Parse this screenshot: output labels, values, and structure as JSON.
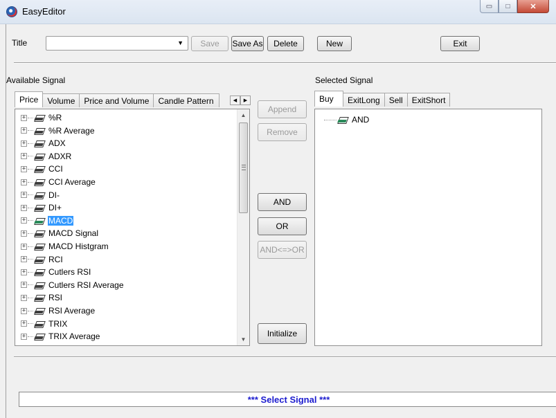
{
  "window": {
    "title": "EasyEditor",
    "min_symbol": "▭",
    "max_symbol": "□",
    "close_symbol": "✕"
  },
  "toolbar": {
    "title_label": "Title",
    "title_value": "",
    "save_label": "Save",
    "save_as_label": "Save As",
    "delete_label": "Delete",
    "new_label": "New",
    "exit_label": "Exit"
  },
  "available": {
    "label": "Available Signal",
    "tabs": [
      "Price",
      "Volume",
      "Price and Volume",
      "Candle Pattern"
    ],
    "items": [
      "%R",
      "%R Average",
      "ADX",
      "ADXR",
      "CCI",
      "CCI Average",
      "DI-",
      "DI+",
      "MACD",
      "MACD Signal",
      "MACD Histgram",
      "RCI",
      "Cutlers RSI",
      "Cutlers RSI Average",
      "RSI",
      "RSI Average",
      "TRIX",
      "TRIX Average"
    ],
    "selected": "MACD"
  },
  "actions": {
    "append": "Append",
    "remove": "Remove",
    "and": "AND",
    "or": "OR",
    "and_or": "AND<=>OR",
    "initialize": "Initialize"
  },
  "selected_signal": {
    "label": "Selected Signal",
    "tabs": [
      "Buy",
      "ExitLong",
      "Sell",
      "ExitShort"
    ],
    "root": "AND"
  },
  "status": "*** Select Signal ***"
}
